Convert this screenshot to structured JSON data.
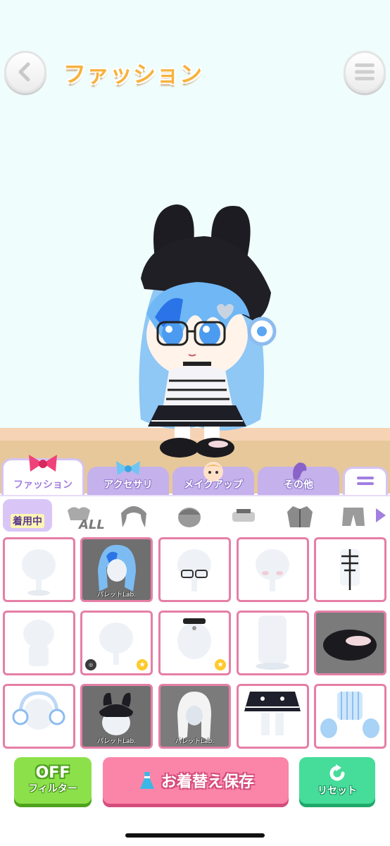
{
  "header": {
    "title": "ファッション",
    "back_icon": "chevron-left-icon",
    "menu_icon": "hamburger-menu-icon"
  },
  "tabs": [
    {
      "label": "ファッション",
      "icon": "ribbon-bow-icon",
      "active": true
    },
    {
      "label": "アクセサリ",
      "icon": "blue-bow-icon",
      "active": false
    },
    {
      "label": "メイクアップ",
      "icon": "face-icon",
      "active": false
    },
    {
      "label": "その他",
      "icon": "pony-icon",
      "active": false
    },
    {
      "label": "",
      "icon": "more-lines-icon",
      "active": false
    }
  ],
  "subcategories": {
    "worn_label": "着用中",
    "all_label": "ALL",
    "items": [
      "hair-icon",
      "head-icon",
      "eyewear-icon",
      "top-icon",
      "jacket-icon",
      "bottoms-icon"
    ]
  },
  "grid": {
    "brand_label": "パレットLab."
  },
  "actions": {
    "filter_top": "OFF",
    "filter_bottom": "フィルター",
    "save_label": "お着替え保存",
    "reset_label": "リセット"
  },
  "colors": {
    "stage_bg": "#effdfc",
    "accent_purple": "#a27fe0",
    "cell_border": "#e57fa6",
    "filter_green": "#8ce14b",
    "save_pink": "#fb85a9",
    "reset_green": "#46dc9a"
  }
}
